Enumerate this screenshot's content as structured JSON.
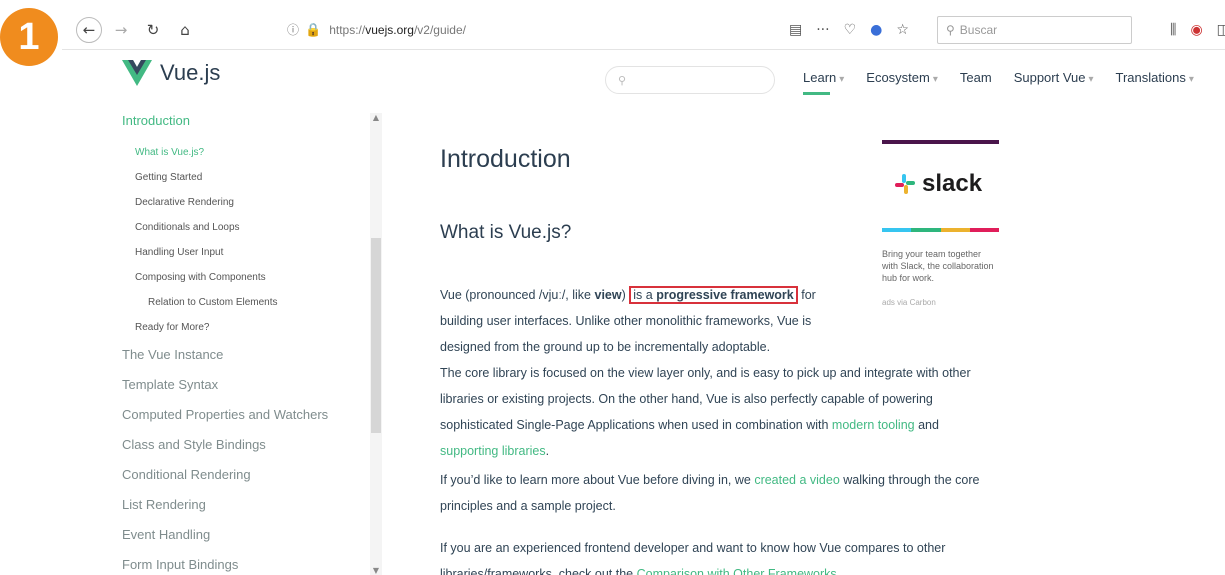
{
  "badge": "1",
  "browser": {
    "url_prefix": "https://",
    "url_host": "vuejs.org",
    "url_path": "/v2/guide/",
    "search_placeholder": "Buscar"
  },
  "site": {
    "logo_text": "Vue.js",
    "nav": [
      {
        "label": "Learn",
        "caret": true
      },
      {
        "label": "Ecosystem",
        "caret": true
      },
      {
        "label": "Team",
        "caret": false
      },
      {
        "label": "Support Vue",
        "caret": true
      },
      {
        "label": "Translations",
        "caret": true
      }
    ]
  },
  "sidebar": {
    "section": "Introduction",
    "subitems": [
      "What is Vue.js?",
      "Getting Started",
      "Declarative Rendering",
      "Conditionals and Loops",
      "Handling User Input",
      "Composing with Components",
      "Relation to Custom Elements",
      "Ready for More?"
    ],
    "topitems": [
      "The Vue Instance",
      "Template Syntax",
      "Computed Properties and Watchers",
      "Class and Style Bindings",
      "Conditional Rendering",
      "List Rendering",
      "Event Handling",
      "Form Input Bindings"
    ]
  },
  "content": {
    "title": "Introduction",
    "section_title": "What is Vue.js?",
    "p1_a": "Vue (pronounced /vjuː/, like ",
    "p1_b": "view",
    "p1_c": ") ",
    "p1_hl_a": "is a ",
    "p1_hl_b": "progressive framework",
    "p1_d": " for building user interfaces. Unlike other monolithic frameworks, Vue is designed from the ground up to be incrementally adoptable.",
    "p2_a": "The core library is focused on the view layer only, and is easy to pick up and integrate with other libraries or existing projects. On the other hand, Vue is also perfectly capable of powering sophisticated Single-Page Applications when used in combination with ",
    "p2_link1": "modern tooling",
    "p2_b": " and ",
    "p2_link2": "supporting libraries",
    "p2_c": ".",
    "p3_a": "If you’d like to learn more about Vue before diving in, we ",
    "p3_link": "created a video",
    "p3_b": " walking through the core principles and a sample project.",
    "p4_a": "If you are an experienced frontend developer and want to know how Vue compares to other libraries/frameworks, check out the ",
    "p4_link": "Comparison with Other Frameworks",
    "p4_b": "."
  },
  "ad": {
    "brand": "slack",
    "desc": "Bring your team together with Slack, the collaboration hub for work.",
    "via": "ads via Carbon",
    "colors": [
      "#36c5f0",
      "#2eb67d",
      "#ecb22e",
      "#e01e5a"
    ]
  }
}
